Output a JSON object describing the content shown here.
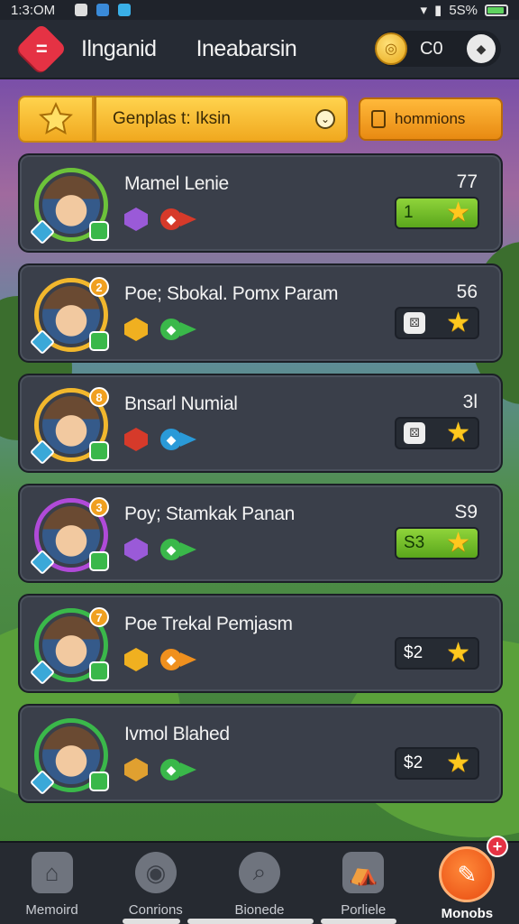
{
  "status_bar": {
    "time": "1:3:OM",
    "battery": "5S%"
  },
  "header": {
    "title": "Ilnganid",
    "subtitle": "Ineabarsin",
    "coins": "C0"
  },
  "controls": {
    "filter_label": "Genplas t: Iksin",
    "sort_label": "hommions"
  },
  "players": [
    {
      "name": "Mamel Lenie",
      "score": "77",
      "reward": "1",
      "reward_style": "green",
      "avatar_color": "#6cc23a",
      "badge_top": "",
      "rank_color": "#d63a2a",
      "gem_color": "#9a5ad8"
    },
    {
      "name": "Poe; Sbokal. Pomx Param",
      "score": "56",
      "reward": "",
      "reward_style": "dark",
      "avatar_color": "#f1b72d",
      "badge_top": "2",
      "rank_color": "#3ab84a",
      "gem_color": "#f0b020"
    },
    {
      "name": "Bnsarl Numial",
      "score": "3l",
      "reward": "",
      "reward_style": "dark",
      "avatar_color": "#f1b72d",
      "badge_top": "8",
      "rank_color": "#2a9ad8",
      "gem_color": "#d63a2a"
    },
    {
      "name": "Poy; Stamkak Panan",
      "score": "S9",
      "reward": "S3",
      "reward_style": "green",
      "avatar_color": "#b04ad8",
      "badge_top": "3",
      "rank_color": "#3ab84a",
      "gem_color": "#9a5ad8"
    },
    {
      "name": "Poe Trekal Pemjasm",
      "score": "",
      "reward": "$2",
      "reward_style": "dark",
      "avatar_color": "#3ab84a",
      "badge_top": "7",
      "rank_color": "#f0901e",
      "gem_color": "#f0b020"
    },
    {
      "name": "Ivmol Blahed",
      "score": "",
      "reward": "$2",
      "reward_style": "dark",
      "avatar_color": "#3ab84a",
      "badge_top": "",
      "rank_color": "#3ab84a",
      "gem_color": "#e0a030"
    }
  ],
  "nav": [
    {
      "label": "Memoird",
      "icon": "house-icon"
    },
    {
      "label": "Conrions",
      "icon": "coins-icon"
    },
    {
      "label": "Bionede",
      "icon": "search-icon"
    },
    {
      "label": "Porliele",
      "icon": "shop-icon"
    },
    {
      "label": "Monobs",
      "icon": "chat-icon",
      "notification": "+"
    }
  ]
}
